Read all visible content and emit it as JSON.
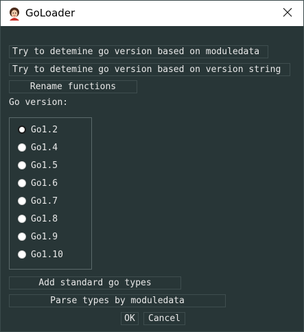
{
  "window": {
    "title": "GoLoader"
  },
  "buttons": {
    "detect_moduledata": "Try to detemine go version based on moduledata",
    "detect_version_string": "Try to detemine go version based on version string",
    "rename_functions": "Rename functions",
    "add_standard_types": "Add standard go types",
    "parse_types": "Parse types by moduledata",
    "ok": "OK",
    "cancel": "Cancel"
  },
  "go_version_label": "Go version:",
  "versions": [
    {
      "label": "Go1.2",
      "selected": true
    },
    {
      "label": "Go1.4",
      "selected": false
    },
    {
      "label": "Go1.5",
      "selected": false
    },
    {
      "label": "Go1.6",
      "selected": false
    },
    {
      "label": "Go1.7",
      "selected": false
    },
    {
      "label": "Go1.8",
      "selected": false
    },
    {
      "label": "Go1.9",
      "selected": false
    },
    {
      "label": "Go1.10",
      "selected": false
    }
  ],
  "icons": {
    "app": "gopher-avatar-icon",
    "close": "close-icon"
  }
}
